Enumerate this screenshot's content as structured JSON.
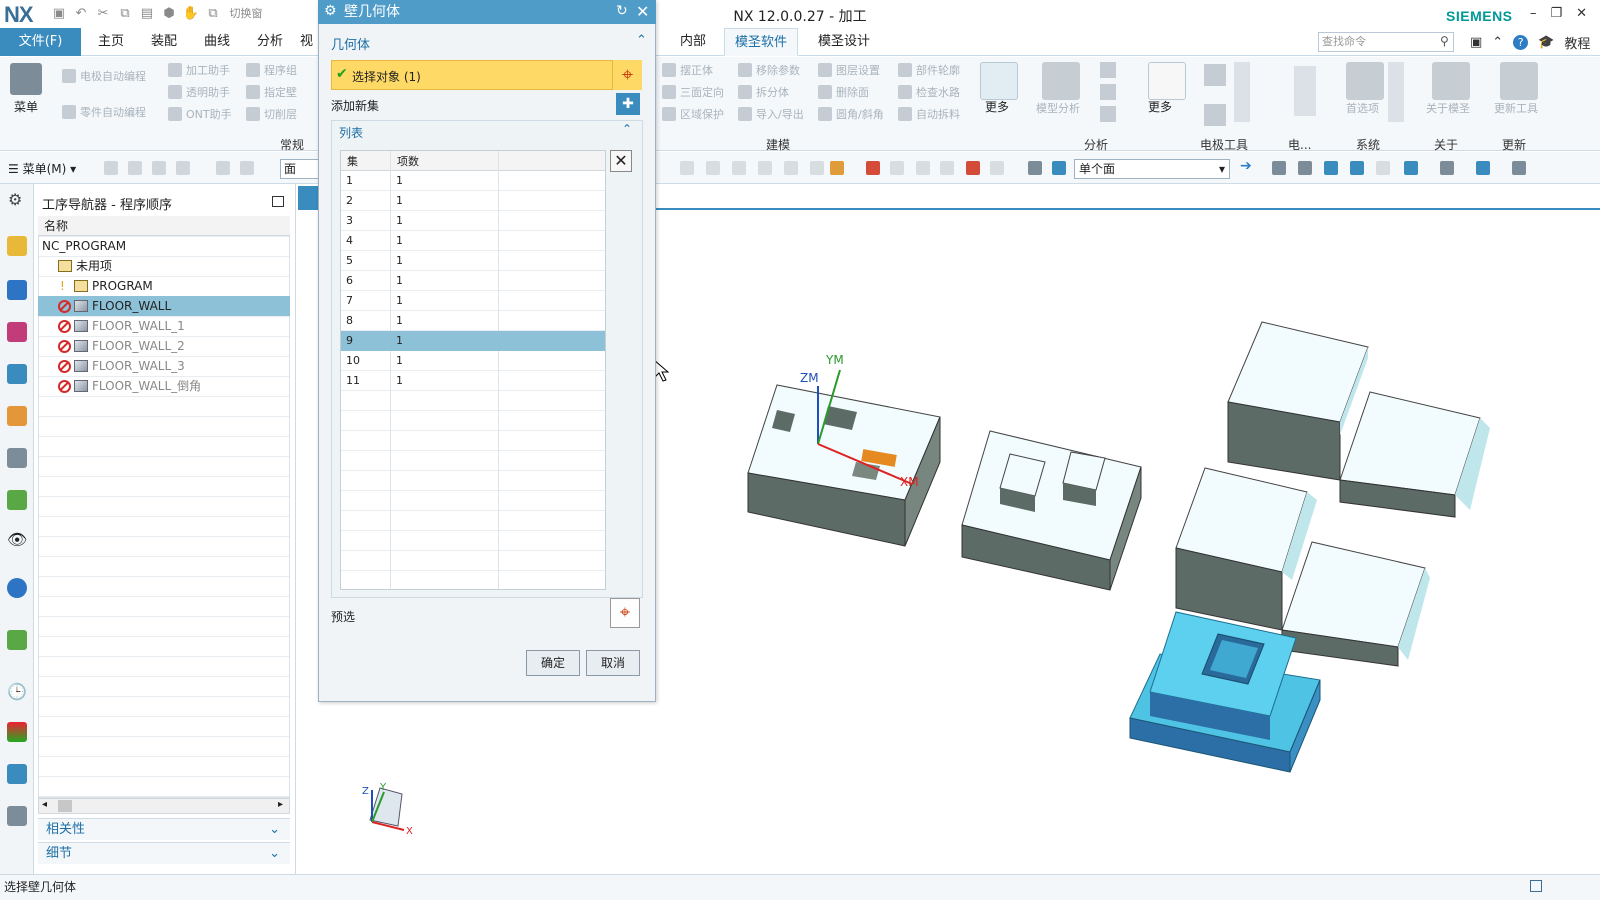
{
  "app": {
    "logo": "NX",
    "title": "NX 12.0.0.27 - 加工",
    "brand": "SIEMENS",
    "switch_window": "切换窗"
  },
  "tabs": [
    "文件(F)",
    "主页",
    "装配",
    "曲线",
    "分析",
    "视",
    "内部",
    "模圣软件",
    "模圣设计"
  ],
  "active_tab": "模圣软件",
  "search": {
    "placeholder": "查找命令"
  },
  "help_label": "教程",
  "ribbon": {
    "menu_label": "菜单",
    "left_items": [
      "电极自动编程",
      "加工助手",
      "程序组",
      "零件自动编程",
      "透明助手",
      "指定壁",
      "ONT助手",
      "切削层"
    ],
    "left_group": "常规",
    "mid_items": [
      "摆正体",
      "移除参数",
      "图层设置",
      "部件轮廓",
      "三面定向",
      "拆分体",
      "删除面",
      "检查水路",
      "区域保护",
      "导入/导出",
      "圆角/斜角",
      "自动拆料"
    ],
    "more_label": "更多",
    "groups": [
      "建模",
      "分析",
      "电极工具",
      "电...",
      "系统",
      "关于",
      "更新"
    ],
    "big_buttons": [
      "模型分析",
      "更多",
      "首选项",
      "关于模圣",
      "更新工具"
    ]
  },
  "toolbar2": {
    "menu_label": "菜单(M)",
    "filter_value": "面",
    "face_select_value": "单个面"
  },
  "navigator": {
    "title": "工序导航器 - 程序顺序",
    "column_header": "名称",
    "rows": [
      {
        "label": "NC_PROGRAM"
      },
      {
        "label": "未用项"
      },
      {
        "label": "PROGRAM"
      },
      {
        "label": "FLOOR_WALL"
      },
      {
        "label": "FLOOR_WALL_1"
      },
      {
        "label": "FLOOR_WALL_2"
      },
      {
        "label": "FLOOR_WALL_3"
      },
      {
        "label": "FLOOR_WALL_倒角"
      }
    ],
    "panels": [
      "相关性",
      "细节"
    ]
  },
  "dialog": {
    "title": "壁几何体",
    "section_geometry": "几何体",
    "select_label": "选择对象 (1)",
    "add_set": "添加新集",
    "section_list": "列表",
    "columns": [
      "集",
      "项数"
    ],
    "rows": [
      [
        "1",
        "1"
      ],
      [
        "2",
        "1"
      ],
      [
        "3",
        "1"
      ],
      [
        "4",
        "1"
      ],
      [
        "5",
        "1"
      ],
      [
        "6",
        "1"
      ],
      [
        "7",
        "1"
      ],
      [
        "8",
        "1"
      ],
      [
        "9",
        "1"
      ],
      [
        "10",
        "1"
      ],
      [
        "11",
        "1"
      ]
    ],
    "selected_row": "9",
    "preselect_label": "预选",
    "ok": "确定",
    "cancel": "取消"
  },
  "viewport": {
    "axis_labels": [
      "ZM",
      "YM",
      "XM"
    ],
    "triad_labels": [
      "Z",
      "Y",
      "X"
    ]
  },
  "status_text": "选择壁几何体",
  "colors": {
    "accent": "#3a8cbf",
    "selection_yellow": "#ffd966",
    "selected_row": "#8dc1d8",
    "part_blue": "#4fc3e3",
    "part_gray": "#556560"
  }
}
